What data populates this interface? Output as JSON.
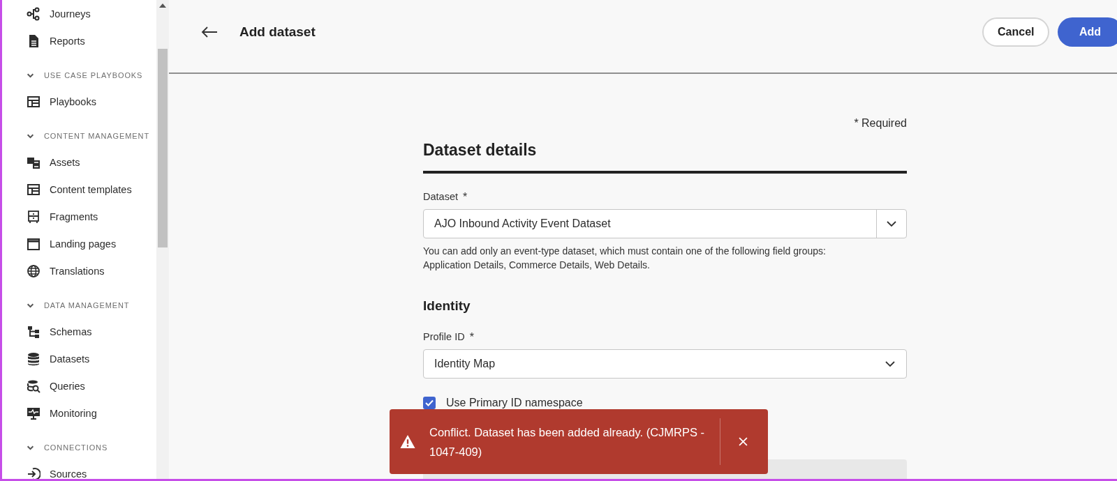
{
  "sidebar": {
    "sections": [
      {
        "items": [
          {
            "label": "Journeys"
          },
          {
            "label": "Reports"
          }
        ]
      },
      {
        "heading": "USE CASE PLAYBOOKS",
        "expanded": true,
        "items": [
          {
            "label": "Playbooks"
          }
        ]
      },
      {
        "heading": "CONTENT MANAGEMENT",
        "expanded": true,
        "items": [
          {
            "label": "Assets"
          },
          {
            "label": "Content templates"
          },
          {
            "label": "Fragments"
          },
          {
            "label": "Landing pages"
          },
          {
            "label": "Translations"
          }
        ]
      },
      {
        "heading": "DATA MANAGEMENT",
        "expanded": true,
        "items": [
          {
            "label": "Schemas"
          },
          {
            "label": "Datasets"
          },
          {
            "label": "Queries"
          },
          {
            "label": "Monitoring"
          }
        ]
      },
      {
        "heading": "CONNECTIONS",
        "expanded": true,
        "items": [
          {
            "label": "Sources"
          }
        ]
      }
    ]
  },
  "header": {
    "title": "Add dataset",
    "buttons": [
      {
        "label": "Cancel",
        "kind": "secondary"
      },
      {
        "label": "Add",
        "kind": "primary"
      }
    ]
  },
  "form": {
    "required_note": "* Required",
    "title": "Dataset details",
    "dataset": {
      "label": "Dataset",
      "required_mark": "*",
      "value": "AJO Inbound Activity Event Dataset",
      "help": "You can add only an event-type dataset, which must contain one of the following field groups: Application Details, Commerce Details, Web Details."
    },
    "identity": {
      "title": "Identity",
      "profile_id": {
        "label": "Profile ID",
        "required_mark": "*",
        "value": "Identity Map"
      },
      "checkbox": {
        "label": "Use Primary ID namespace",
        "checked": true
      }
    }
  },
  "toast": {
    "kind": "error",
    "message": "Conflict. Dataset has been added already. (CJMRPS - 1047-409)"
  }
}
